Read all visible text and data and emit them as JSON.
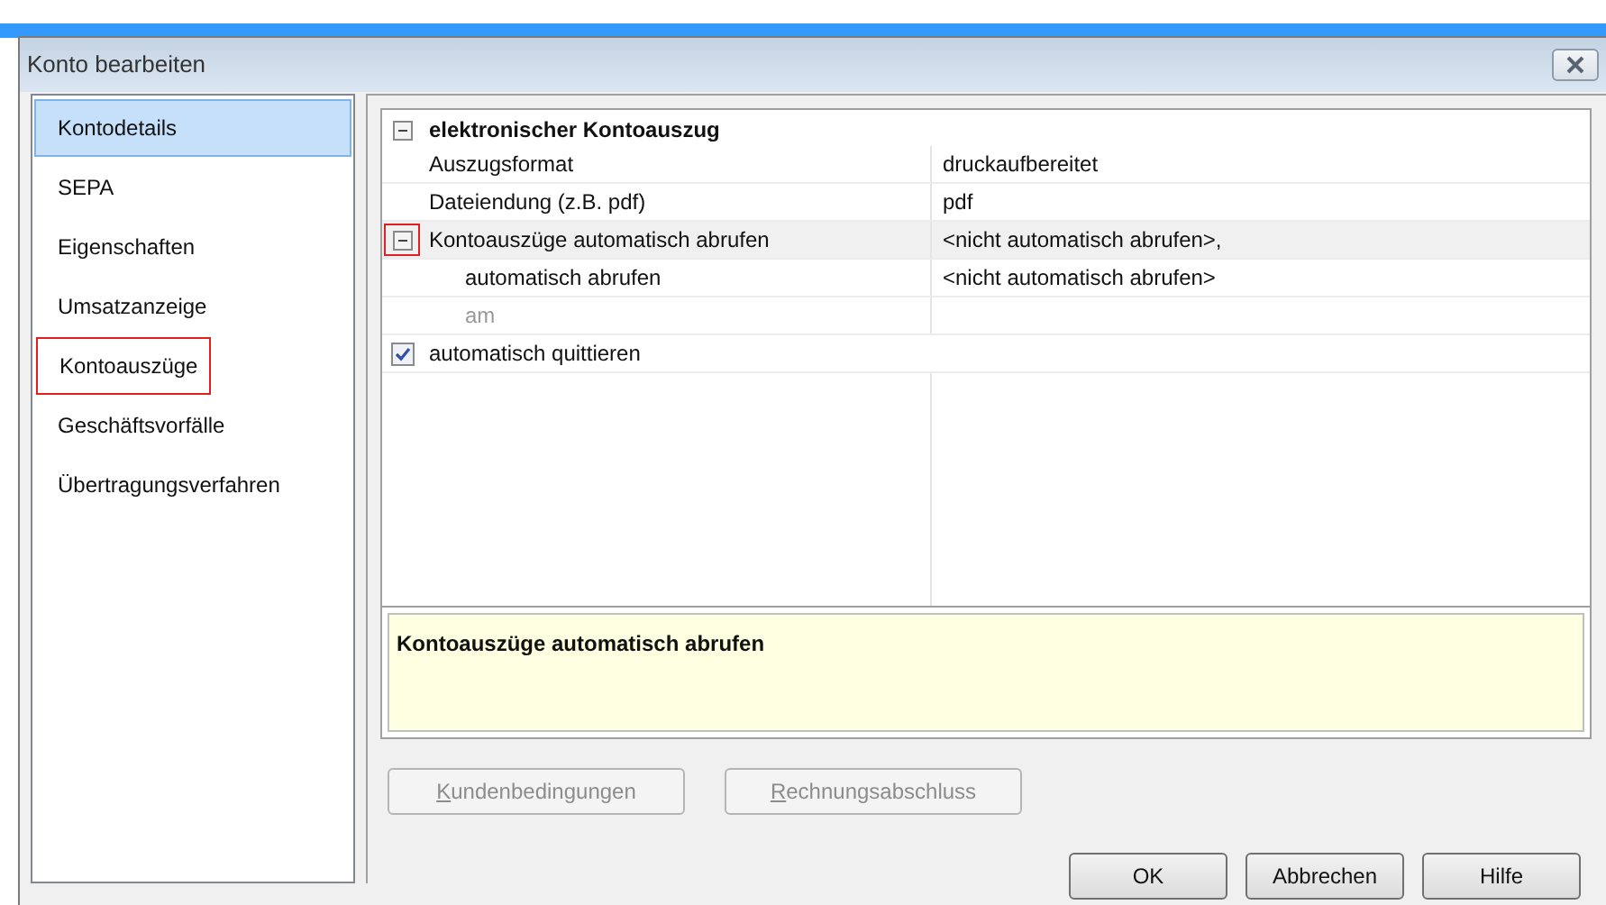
{
  "window": {
    "title": "Konto bearbeiten"
  },
  "sidebar": {
    "items": [
      {
        "label": "Kontodetails",
        "selected": true,
        "annotated": false
      },
      {
        "label": "SEPA",
        "selected": false,
        "annotated": false
      },
      {
        "label": "Eigenschaften",
        "selected": false,
        "annotated": false
      },
      {
        "label": "Umsatzanzeige",
        "selected": false,
        "annotated": false
      },
      {
        "label": "Kontoauszüge",
        "selected": false,
        "annotated": true
      },
      {
        "label": "Geschäftsvorfälle",
        "selected": false,
        "annotated": false
      },
      {
        "label": "Übertragungsverfahren",
        "selected": false,
        "annotated": false
      }
    ]
  },
  "property_grid": {
    "category": {
      "label": "elektronischer Kontoauszug",
      "expanded": true
    },
    "rows": [
      {
        "kind": "property",
        "label": "Auszugsformat",
        "value": "druckaufbereitet"
      },
      {
        "kind": "property",
        "label": "Dateiendung (z.B. pdf)",
        "value": "pdf"
      },
      {
        "kind": "group",
        "label": "Kontoauszüge automatisch abrufen",
        "value": "<nicht automatisch abrufen>,",
        "expanded": true,
        "annotated": true,
        "children": [
          {
            "kind": "property",
            "label": "automatisch abrufen",
            "value": "<nicht automatisch abrufen>",
            "disabled": false
          },
          {
            "kind": "property",
            "label": "am",
            "disabled": true
          }
        ]
      },
      {
        "kind": "checkbox",
        "label": "automatisch quittieren",
        "checked": true
      }
    ]
  },
  "description": {
    "text": "Kontoauszüge automatisch abrufen"
  },
  "panel_buttons": [
    {
      "label": "Kundenbedingungen",
      "disabled": true
    },
    {
      "label": "Rechnungsabschluss",
      "disabled": true
    }
  ],
  "buttons": [
    {
      "label": "OK"
    },
    {
      "label": "Abbrechen"
    },
    {
      "label": "Hilfe"
    }
  ]
}
